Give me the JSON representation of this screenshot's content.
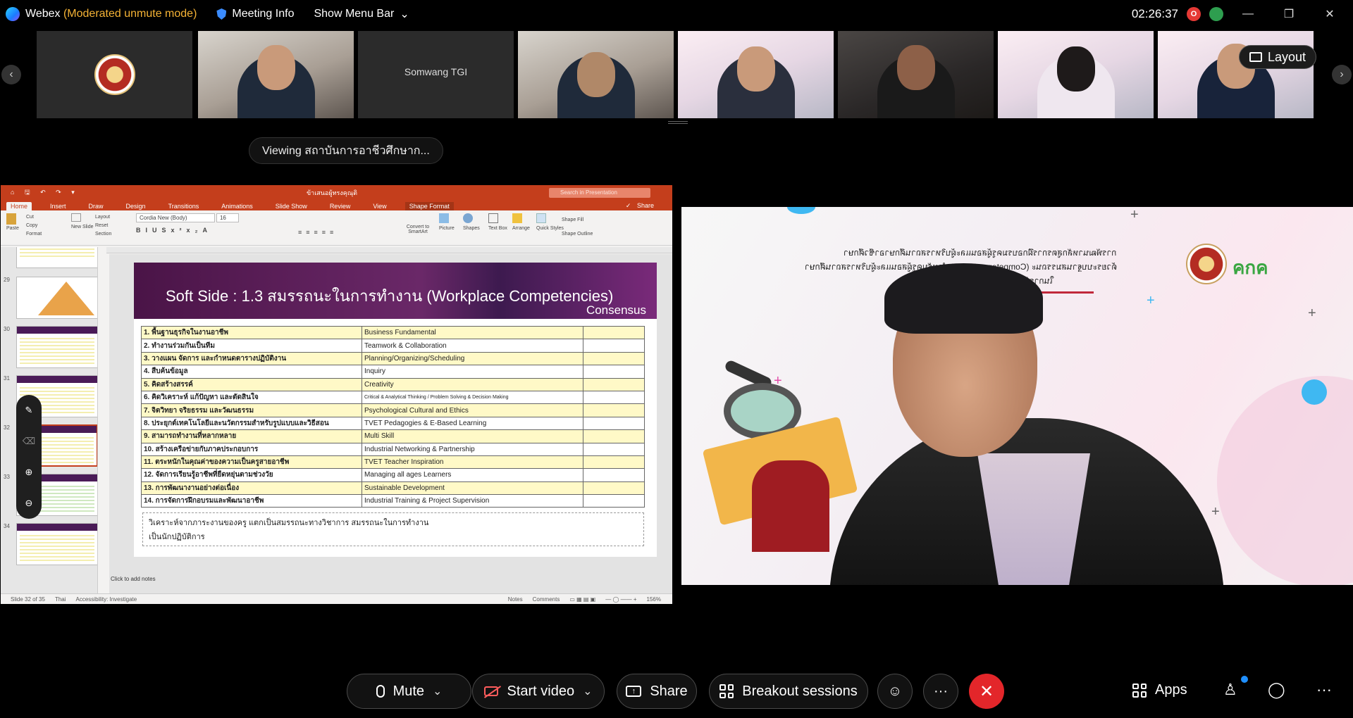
{
  "topbar": {
    "app_name": "Webex",
    "mode": "(Moderated unmute mode)",
    "meeting_info": "Meeting Info",
    "show_menu_bar": "Show Menu Bar",
    "clock": "02:26:37",
    "rec_label": "O"
  },
  "filmstrip": {
    "participant_name": "Somwang TGI",
    "layout_label": "Layout"
  },
  "viewing_label": "Viewing สถาบันการอาชีวศึกษาก...",
  "ppt": {
    "file_name": "ข้าเสนอผู้ทรงคุณุติ",
    "search_placeholder": "Search in Presentation",
    "tabs": [
      "Home",
      "Insert",
      "Draw",
      "Design",
      "Transitions",
      "Animations",
      "Slide Show",
      "Review",
      "View",
      "Shape Format"
    ],
    "share_label": "Share",
    "font_name": "Cordia New (Body)",
    "font_size": "16",
    "ribbon_labels": {
      "paste": "Paste",
      "cut": "Cut",
      "copy": "Copy",
      "format": "Format",
      "new_slide": "New Slide",
      "layout": "Layout",
      "reset": "Reset",
      "section": "Section",
      "convert": "Convert to SmartArt",
      "picture": "Picture",
      "shapes": "Shapes",
      "text_box": "Text Box",
      "arrange": "Arrange",
      "quick_styles": "Quick Styles",
      "shape_fill": "Shape Fill",
      "shape_outline": "Shape Outline"
    },
    "thumb_numbers": [
      "29",
      "30",
      "31",
      "32",
      "33",
      "34"
    ],
    "slide": {
      "title": "Soft Side : 1.3 สมรรถนะในการทำงาน (Workplace Competencies)",
      "consensus": "Consensus",
      "rows": [
        {
          "th": "1. พื้นฐานธุรกิจในงานอาชีพ",
          "en": "Business Fundamental"
        },
        {
          "th": "2. ทำงานร่วมกันเป็นทีม",
          "en": "Teamwork & Collaboration"
        },
        {
          "th": "3. วางแผน จัดการ และกำหนดตารางปฏิบัติงาน",
          "en": "Planning/Organizing/Scheduling"
        },
        {
          "th": "4. สืบค้นข้อมูล",
          "en": "Inquiry"
        },
        {
          "th": "5. คิดสร้างสรรค์",
          "en": "Creativity"
        },
        {
          "th": "6. คิดวิเคราะห์ แก้ปัญหา และตัดสินใจ",
          "en": "Critical & Analytical Thinking / Problem Solving & Decision Making"
        },
        {
          "th": "7. จิตวิทยา จริยธรรม และวัฒนธรรม",
          "en": "Psychological Cultural and Ethics"
        },
        {
          "th": "8. ประยุกต์เทคโนโลยีและนวัตกรรมสำหรับรูปแบบและวิธีสอน",
          "en": "TVET Pedagogies & E-Based Learning"
        },
        {
          "th": "9. สามารถทำงานที่หลากหลาย",
          "en": "Multi Skill"
        },
        {
          "th": "10. สร้างเครือข่ายกับภาคประกอบการ",
          "en": "Industrial Networking &  Partnership"
        },
        {
          "th": "11. ตระหนักในคุณค่าของความเป็นครูสายอาชีพ",
          "en": "TVET Teacher Inspiration"
        },
        {
          "th": "12. จัดการเรียนรู้อาชีพที่ยืดหยุ่นตามช่วงวัย",
          "en": "Managing all ages Learners"
        },
        {
          "th": "13. การพัฒนางานอย่างต่อเนื่อง",
          "en": "Sustainable Development"
        },
        {
          "th": "14. การจัดการฝึกอบรมและพัฒนาอาชีพ",
          "en": "Industrial Training & Project Supervision"
        }
      ],
      "textbox_line1": "วิเคราะห์จากภาระงานของครู  แตกเป็นสมรรถนะทางวิชาการ สมรรถนะในการทำงาน",
      "textbox_line2": "เป็นนักปฏิบัติการ"
    },
    "notes_placeholder": "Click to add notes",
    "status": {
      "slide_of": "Slide 32 of 35",
      "language": "Thai",
      "accessibility": "Accessibility: Investigate",
      "notes": "Notes",
      "comments": "Comments",
      "zoom": "156%"
    }
  },
  "speaker": {
    "title_line1": "การพัฒนาหลักสูตรการฝึกอบรมครูผู้สอนและผู้บริหารสถานศึกษาอาชีวศึกษา",
    "title_line2": "ด้วยระบบฐานสมรรถนะ (Competency-based) สำหรับครูผู้สอนและผู้บริหารสถานศึกษา",
    "title_line3": "ในการจัดการเรียนการสอน",
    "logo_text": "คกค"
  },
  "controls": {
    "mute": "Mute",
    "start_video": "Start video",
    "share": "Share",
    "breakout": "Breakout sessions",
    "apps": "Apps"
  },
  "colors": {
    "ppt_accent": "#c43e1c",
    "end_call": "#e3262a",
    "mode_text": "#f5b335"
  }
}
